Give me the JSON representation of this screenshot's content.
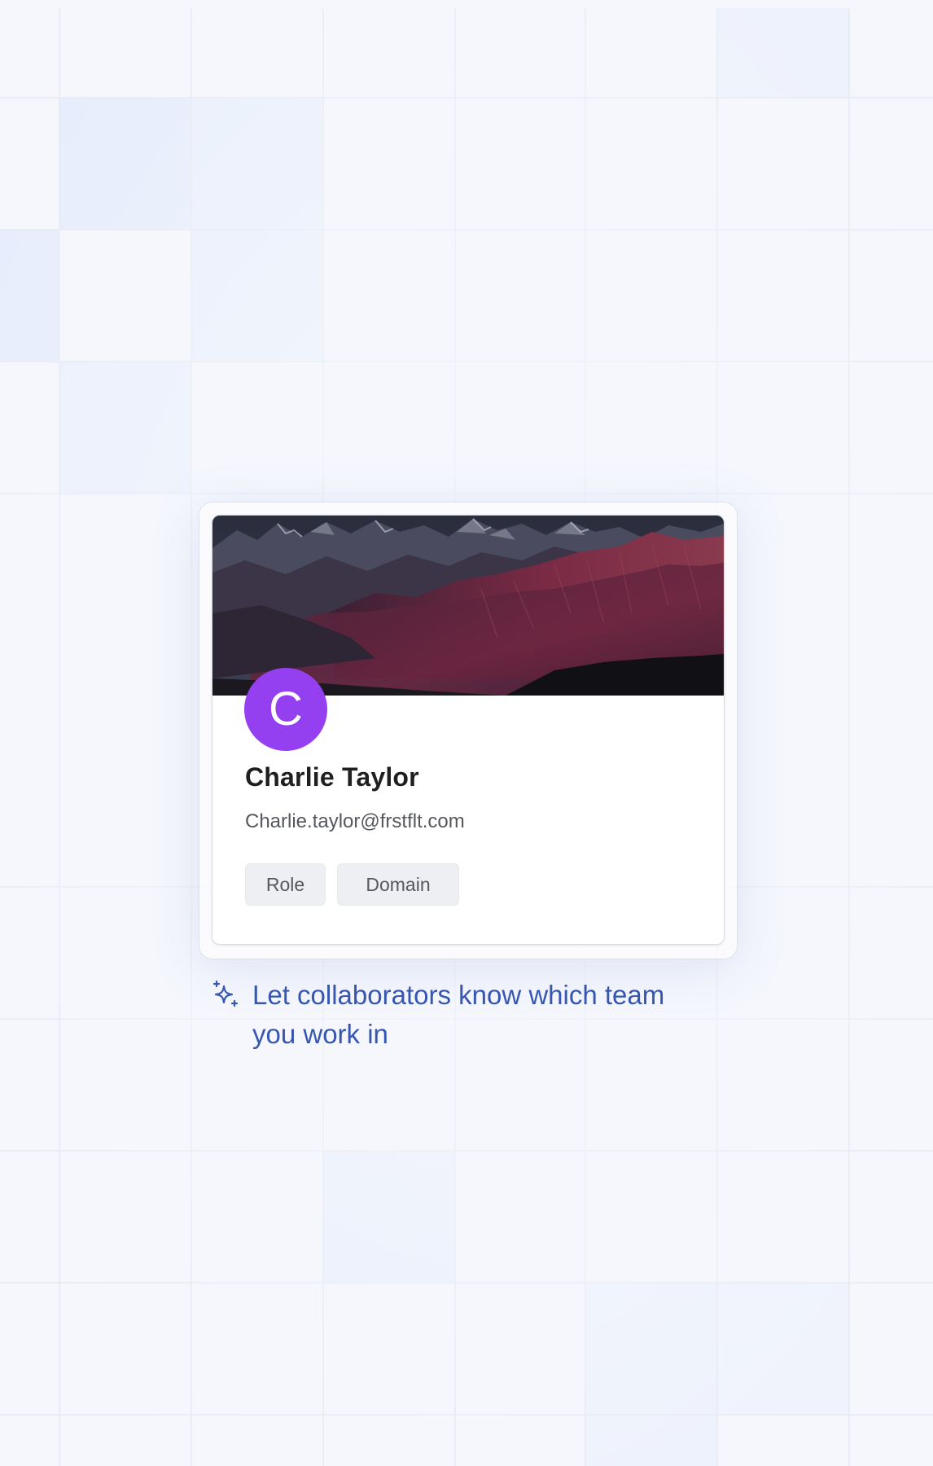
{
  "profile_card": {
    "avatar_initial": "C",
    "name": "Charlie Taylor",
    "email": "Charlie.taylor@frstflt.com",
    "tags": [
      "Role",
      "Domain"
    ]
  },
  "hint": {
    "icon": "sparkles-icon",
    "text": "Let collaborators know which team you work in"
  },
  "colors": {
    "page_background": "#f5f7fd",
    "avatar": "#9440f0",
    "hint_text": "#3756b0",
    "tag_background": "#eeeff2"
  }
}
